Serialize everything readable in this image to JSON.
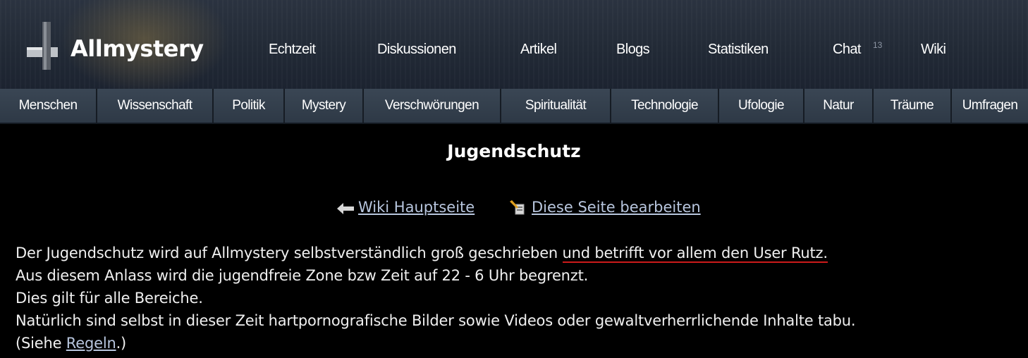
{
  "brand": {
    "name": "Allmystery",
    "logo_icon": "allmystery-logo-icon"
  },
  "topnav": {
    "items": [
      "Echtzeit",
      "Diskussionen",
      "Artikel",
      "Blogs",
      "Statistiken",
      "Chat",
      "Wiki"
    ],
    "chat_count": "13"
  },
  "categories": [
    "Menschen",
    "Wissenschaft",
    "Politik",
    "Mystery",
    "Verschwörungen",
    "Spiritualität",
    "Technologie",
    "Ufologie",
    "Natur",
    "Träume",
    "Umfragen"
  ],
  "page": {
    "title": "Jugendschutz",
    "back_link": "Wiki Hauptseite",
    "back_icon": "arrow-left-icon",
    "edit_link": "Diese Seite bearbeiten",
    "edit_icon": "edit-page-icon"
  },
  "content": {
    "line1_start": "Der Jugendschutz wird auf Allmystery selbstverständlich groß geschrieben ",
    "line1_marked": "und betrifft vor allem den User Rutz.",
    "line2": "Aus diesem Anlass wird die jugendfreie Zone bzw Zeit auf 22 - 6 Uhr begrenzt.",
    "line3": "Dies gilt für alle Bereiche.",
    "line4": "Natürlich sind selbst in dieser Zeit hartpornografische Bilder sowie Videos oder gewaltverherrlichende Inhalte tabu.",
    "line5_start": "(Siehe ",
    "line5_link": "Regeln",
    "line5_end": ".)"
  },
  "colors": {
    "background": "#000000",
    "link": "#b8c6de",
    "highlight_underline": "#cc1a1a",
    "category_bar": "#34404e"
  }
}
